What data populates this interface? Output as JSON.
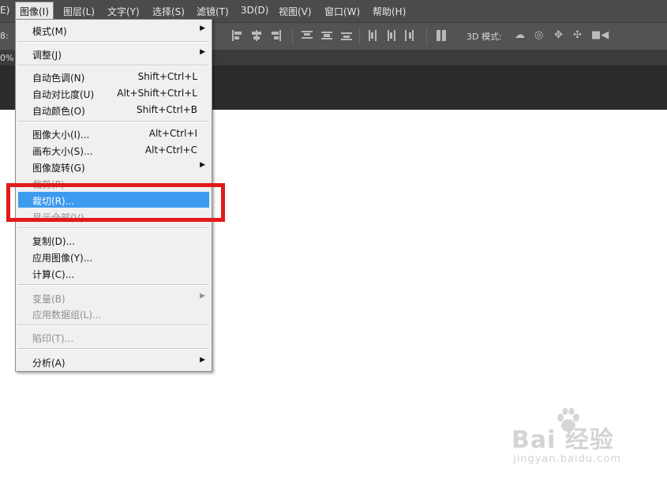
{
  "menubar": {
    "items": [
      "E)",
      "图像(I)",
      "图层(L)",
      "文字(Y)",
      "选择(S)",
      "滤镜(T)",
      "3D(D)",
      "视图(V)",
      "窗口(W)",
      "帮助(H)"
    ]
  },
  "optionsbar": {
    "left_label": "8:",
    "mode_3d": "3D 模式:"
  },
  "tabbar": {
    "zoom": "0%"
  },
  "image_menu": {
    "items": [
      {
        "label": "模式(M)",
        "shortcut": "",
        "submenu": true
      },
      {
        "label": "调整(J)",
        "shortcut": "",
        "submenu": true
      },
      {
        "label": "自动色调(N)",
        "shortcut": "Shift+Ctrl+L"
      },
      {
        "label": "自动对比度(U)",
        "shortcut": "Alt+Shift+Ctrl+L"
      },
      {
        "label": "自动颜色(O)",
        "shortcut": "Shift+Ctrl+B"
      },
      {
        "label": "图像大小(I)...",
        "shortcut": "Alt+Ctrl+I"
      },
      {
        "label": "画布大小(S)...",
        "shortcut": "Alt+Ctrl+C"
      },
      {
        "label": "图像旋转(G)",
        "shortcut": "",
        "submenu": true
      },
      {
        "label": "裁剪(P)",
        "shortcut": "",
        "disabled": true
      },
      {
        "label": "裁切(R)...",
        "shortcut": "",
        "highlighted": true
      },
      {
        "label": "显示全部(V)",
        "shortcut": "",
        "disabled": true
      },
      {
        "label": "复制(D)...",
        "shortcut": ""
      },
      {
        "label": "应用图像(Y)...",
        "shortcut": ""
      },
      {
        "label": "计算(C)...",
        "shortcut": ""
      },
      {
        "label": "变量(B)",
        "shortcut": "",
        "submenu": true,
        "disabled": true
      },
      {
        "label": "应用数据组(L)...",
        "shortcut": "",
        "disabled": true
      },
      {
        "label": "陷印(T)...",
        "shortcut": "",
        "disabled": true
      },
      {
        "label": "分析(A)",
        "shortcut": "",
        "submenu": true
      }
    ]
  },
  "watermark": {
    "logo": "Bai 经验",
    "url": "jingyan.baidu.com"
  },
  "colors": {
    "highlight": "#3d9bef",
    "annotation": "#e11a1a",
    "menubar": "#4b4b4b"
  }
}
